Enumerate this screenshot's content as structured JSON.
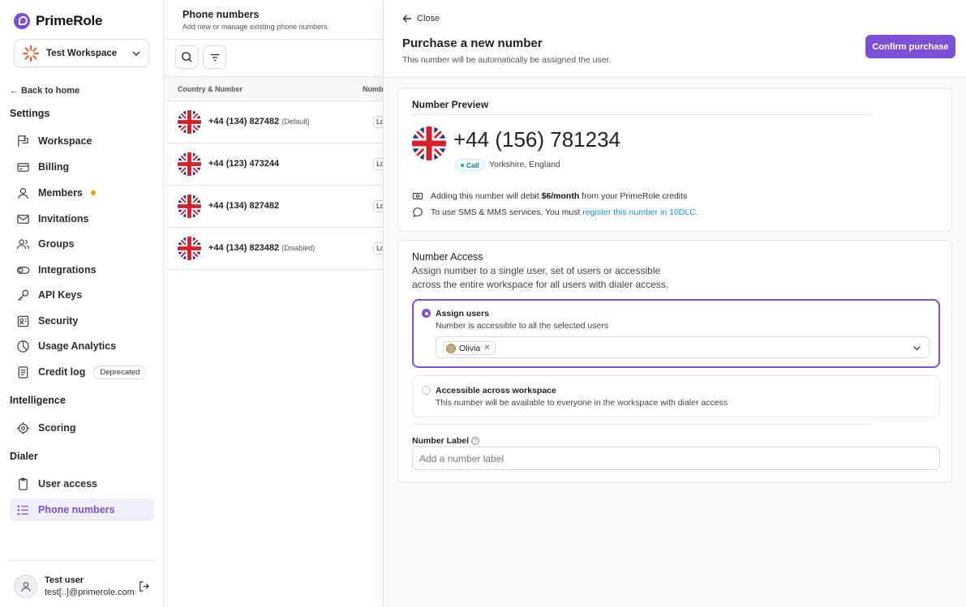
{
  "brand": {
    "name": "PrimeRole"
  },
  "workspace": {
    "name": "Test Workspace"
  },
  "sidebar": {
    "back_label": "Back to home",
    "sections": {
      "settings": "Settings",
      "intelligence": "Intelligence",
      "dialer": "Dialer"
    },
    "items": [
      {
        "label": "Workspace",
        "icon": "flag-icon"
      },
      {
        "label": "Billing",
        "icon": "credit-card-icon"
      },
      {
        "label": "Members",
        "icon": "user-icon",
        "indicator_color": "#f59e0b"
      },
      {
        "label": "Invitations",
        "icon": "mail-icon"
      },
      {
        "label": "Groups",
        "icon": "users-icon"
      },
      {
        "label": "Integrations",
        "icon": "toggle-icon"
      },
      {
        "label": "API Keys",
        "icon": "key-icon"
      },
      {
        "label": "Security",
        "icon": "shield-icon"
      },
      {
        "label": "Usage Analytics",
        "icon": "pie-chart-icon"
      },
      {
        "label": "Credit log",
        "icon": "document-icon",
        "tag": "Deprecated"
      },
      {
        "label": "Scoring",
        "icon": "target-icon"
      },
      {
        "label": "User access",
        "icon": "clipboard-icon"
      },
      {
        "label": "Phone numbers",
        "icon": "list-icon",
        "active": true
      }
    ],
    "user": {
      "name": "Test user",
      "email": "test[..]@primerole.com"
    }
  },
  "phone_list": {
    "title": "Phone numbers",
    "subtitle": "Add new or manage existing phone numbers",
    "columns": [
      "Country & Number",
      "Number"
    ],
    "rows": [
      {
        "number": "+44 (134) 827482",
        "note": "(Default)",
        "chip": "Lo"
      },
      {
        "number": "+44 (123) 473244",
        "note": "",
        "chip": "Lo"
      },
      {
        "number": "+44 (134) 827482",
        "note": "",
        "chip": "Lo"
      },
      {
        "number": "+44 (134) 823482",
        "note": "(Disabled)",
        "chip": "Lo"
      }
    ]
  },
  "purchase": {
    "close_label": "Close",
    "title": "Purchase a new number",
    "subtitle": "This number will be automatically be assigned the user.",
    "confirm_label": "Confirm purchase",
    "preview": {
      "title": "Number Preview",
      "number": "+44 (156) 781234",
      "badge": "Call",
      "location": "Yorkshire, England",
      "debit_prefix": "Adding this number will debit ",
      "debit_amount": "$6/month",
      "debit_suffix": " from your PrimeRole credits",
      "sms_prefix": "To use SMS & MMS services, You must ",
      "sms_link": "register this number in 10DLC."
    },
    "access": {
      "title": "Number Access",
      "description": "Assign number to a single user, set of users or accessible across the entire workspace for all users with dialer access.",
      "options": [
        {
          "title": "Assign users",
          "description": "Number is accessible to all the selected users",
          "selected": true
        },
        {
          "title": "Accessible across workspace",
          "description": "This number will be available to everyone in the workspace with dialer access",
          "selected": false
        }
      ],
      "selected_users": [
        "Olivia"
      ],
      "label_title": "Number Label",
      "label_placeholder": "Add a number label"
    },
    "accent_color": "#7b4fd6"
  }
}
